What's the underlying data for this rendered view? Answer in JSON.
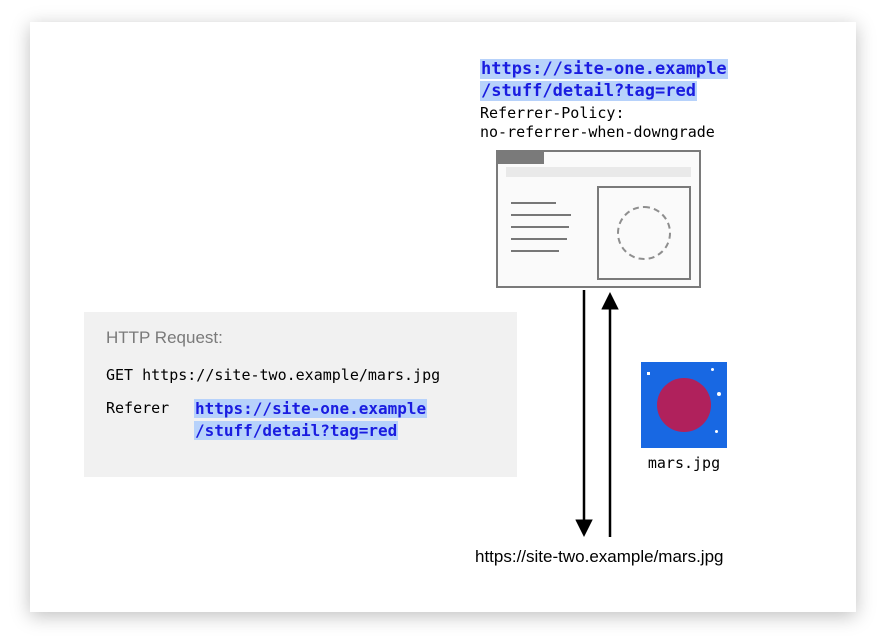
{
  "source": {
    "url_line1": "https://site-one.example",
    "url_line2": "/stuff/detail?tag=red"
  },
  "policy": {
    "label": "Referrer-Policy:",
    "value": "no-referrer-when-downgrade"
  },
  "request": {
    "title": "HTTP Request:",
    "method_line": "GET https://site-two.example/mars.jpg",
    "referer_label": "Referer",
    "referer_value_line1": "https://site-one.example",
    "referer_value_line2": "/stuff/detail?tag=red"
  },
  "resource": {
    "caption": "mars.jpg"
  },
  "destination": {
    "url": "https://site-two.example/mars.jpg"
  }
}
